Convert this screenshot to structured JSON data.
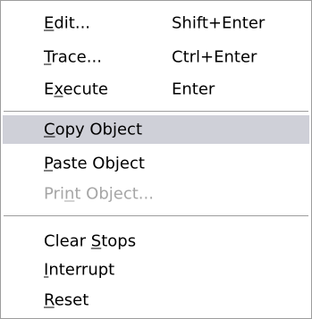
{
  "menu": {
    "items": [
      {
        "pre": "",
        "mn": "E",
        "post": "dit...",
        "shortcut": "Shift+Enter",
        "state": "enabled"
      },
      {
        "pre": "",
        "mn": "T",
        "post": "race...",
        "shortcut": "Ctrl+Enter",
        "state": "enabled"
      },
      {
        "pre": "E",
        "mn": "x",
        "post": "ecute",
        "shortcut": "Enter",
        "state": "enabled"
      },
      {
        "pre": "",
        "mn": "C",
        "post": "opy Object",
        "shortcut": "",
        "state": "highlighted"
      },
      {
        "pre": "",
        "mn": "P",
        "post": "aste Object",
        "shortcut": "",
        "state": "enabled"
      },
      {
        "pre": "Pri",
        "mn": "n",
        "post": "t Object...",
        "shortcut": "",
        "state": "disabled"
      },
      {
        "pre": "Clear ",
        "mn": "S",
        "post": "tops",
        "shortcut": "",
        "state": "enabled"
      },
      {
        "pre": "",
        "mn": "I",
        "post": "nterrupt",
        "shortcut": "",
        "state": "enabled"
      },
      {
        "pre": "",
        "mn": "R",
        "post": "eset",
        "shortcut": "",
        "state": "enabled"
      }
    ],
    "colors": {
      "highlight": "#cfd0d8",
      "disabled_text": "#a6a6a6",
      "border": "#9d9d9d"
    }
  }
}
